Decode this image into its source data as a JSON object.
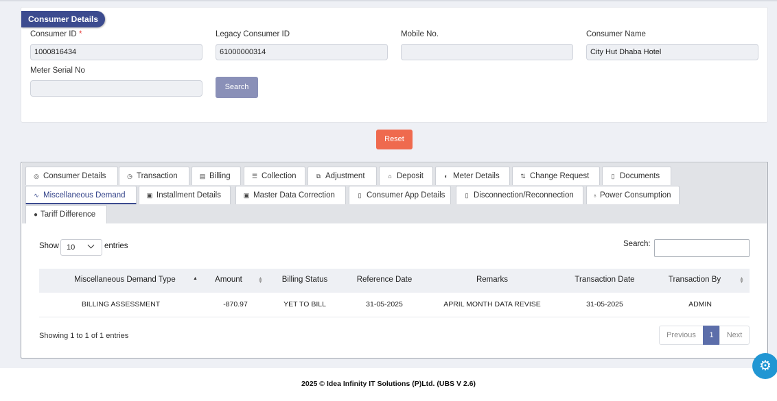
{
  "consumer_details": {
    "title": "Consumer Details",
    "consumer_id_label": "Consumer ID",
    "required_mark": "*",
    "consumer_id_value": "1000816434",
    "legacy_id_label": "Legacy Consumer ID",
    "legacy_id_value": "61000000314",
    "mobile_label": "Mobile No.",
    "mobile_value": "",
    "name_label": "Consumer Name",
    "name_value": "City Hut Dhaba Hotel",
    "meter_label": "Meter Serial No",
    "meter_value": "",
    "search_button": "Search"
  },
  "reset_button": "Reset",
  "tabs": {
    "consumer_details": "Consumer Details",
    "transaction": "Transaction",
    "billing": "Billing",
    "collection": "Collection",
    "adjustment": "Adjustment",
    "deposit": "Deposit",
    "meter_details": "Meter Details",
    "change_request": "Change Request",
    "documents": "Documents",
    "misc_demand": "Miscellaneous Demand",
    "installment": "Installment Details",
    "master_data": "Master Data Correction",
    "consumer_app": "Consumer App Details",
    "disconnection": "Disconnection/Reconnection",
    "power": "Power Consumption",
    "tariff": "Tariff Difference",
    "active": "Miscellaneous Demand"
  },
  "table_controls": {
    "show_label": "Show",
    "entries_value": "10",
    "entries_label": "entries",
    "search_label": "Search:"
  },
  "table": {
    "headers": [
      "Miscellaneous Demand Type",
      "Amount",
      "Billing Status",
      "Reference Date",
      "Remarks",
      "Transaction Date",
      "Transaction By"
    ],
    "rows": [
      [
        "BILLING ASSESSMENT",
        "-870.97",
        "YET TO BILL",
        "31-05-2025",
        "APRIL MONTH DATA REVISE",
        "31-05-2025",
        "ADMIN"
      ]
    ]
  },
  "pagination": {
    "info": "Showing 1 to 1 of 1 entries",
    "previous": "Previous",
    "current": "1",
    "next": "Next"
  },
  "footer": "2025 © Idea Infinity IT Solutions (P)Ltd. (UBS V 2.6)",
  "colors": {
    "primary": "#3c4b8f",
    "reset": "#ef6a4e",
    "search_button": "#8a90b8",
    "settings_fab": "#2196d3"
  },
  "icons": {
    "settings": "gear-icon"
  }
}
